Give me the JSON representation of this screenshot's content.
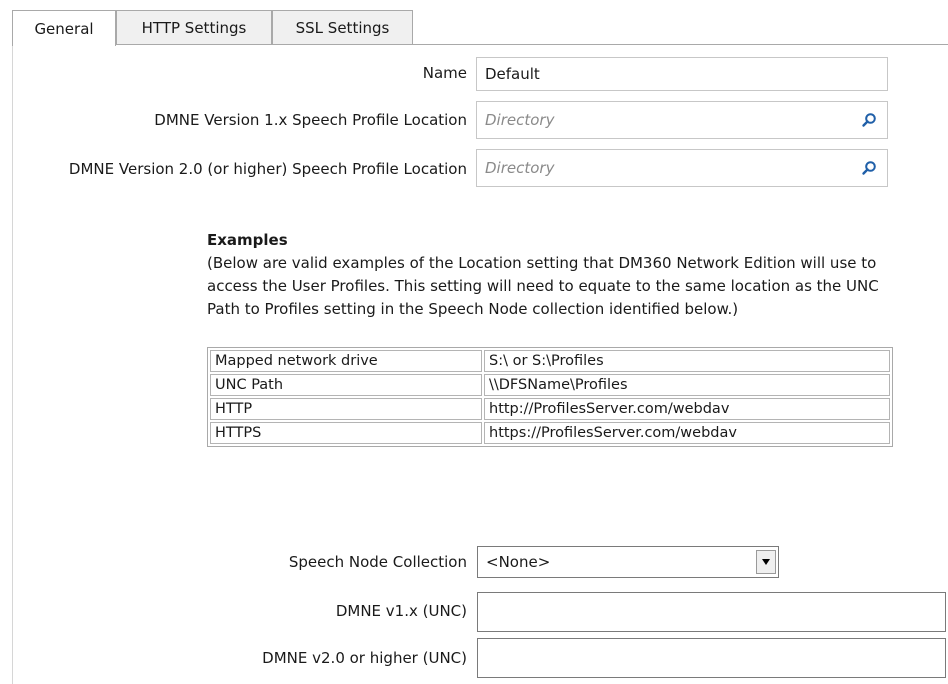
{
  "tabs": [
    {
      "label": "General",
      "active": true
    },
    {
      "label": "HTTP Settings",
      "active": false
    },
    {
      "label": "SSL Settings",
      "active": false
    }
  ],
  "form": {
    "name_label": "Name",
    "name_value": "Default",
    "v1_label": "DMNE Version 1.x Speech Profile Location",
    "v1_placeholder": "Directory",
    "v2_label": "DMNE Version 2.0 (or higher) Speech Profile Location",
    "v2_placeholder": "Directory"
  },
  "examples": {
    "title": "Examples",
    "text": "(Below are valid examples of the Location setting that DM360 Network Edition will use to access the User Profiles. This setting will need to equate to the same location as the UNC Path to Profiles setting in the Speech Node collection identified below.)",
    "rows": [
      {
        "type": "Mapped network drive",
        "example": "S:\\ or S:\\Profiles"
      },
      {
        "type": "UNC Path",
        "example": "\\\\DFSName\\Profiles"
      },
      {
        "type": "HTTP",
        "example": "http://ProfilesServer.com/webdav"
      },
      {
        "type": "HTTPS",
        "example": "https://ProfilesServer.com/webdav"
      }
    ]
  },
  "speech_node": {
    "label": "Speech Node Collection",
    "selected": "<None>",
    "unc_v1_label": "DMNE v1.x (UNC)",
    "unc_v1_value": "",
    "unc_v2_label": "DMNE v2.0 or higher (UNC)",
    "unc_v2_value": ""
  },
  "colors": {
    "icon_blue": "#1f5fa8",
    "border": "#a9a9a9"
  },
  "icons": {
    "browse": "search-icon",
    "dropdown": "chevron-down-icon"
  }
}
